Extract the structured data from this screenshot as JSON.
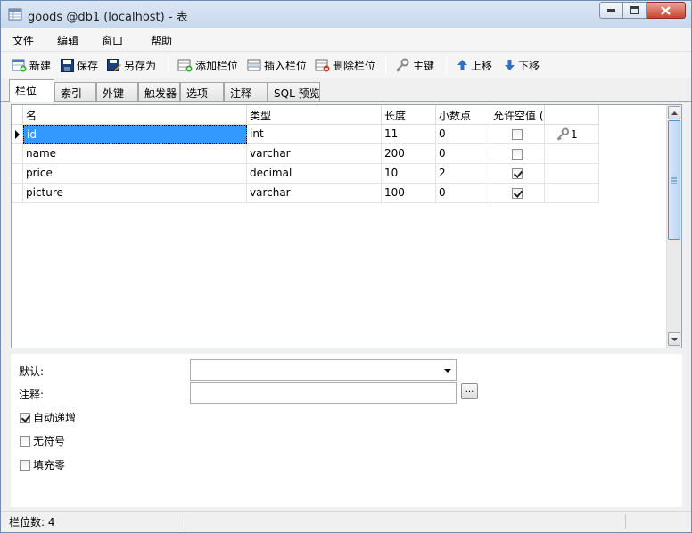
{
  "window": {
    "title": "goods @db1 (localhost) - 表"
  },
  "menu": [
    "文件",
    "编辑",
    "窗口",
    "帮助"
  ],
  "toolbar": {
    "new": "新建",
    "save": "保存",
    "save_as": "另存为",
    "add_field": "添加栏位",
    "insert_field": "插入栏位",
    "delete_field": "删除栏位",
    "primary_key": "主键",
    "move_up": "上移",
    "move_down": "下移"
  },
  "tabs": [
    "栏位",
    "索引",
    "外键",
    "触发器",
    "选项",
    "注释",
    "SQL 预览"
  ],
  "grid": {
    "columns": [
      "名",
      "类型",
      "长度",
      "小数点",
      "允许空值 (",
      ""
    ],
    "rows": [
      {
        "name": "id",
        "type": "int",
        "length": "11",
        "decimals": "0",
        "allow_null": false,
        "key": "1",
        "is_key": true,
        "selected": true
      },
      {
        "name": "name",
        "type": "varchar",
        "length": "200",
        "decimals": "0",
        "allow_null": false,
        "key": "",
        "is_key": false,
        "selected": false
      },
      {
        "name": "price",
        "type": "decimal",
        "length": "10",
        "decimals": "2",
        "allow_null": true,
        "key": "",
        "is_key": false,
        "selected": false
      },
      {
        "name": "picture",
        "type": "varchar",
        "length": "100",
        "decimals": "0",
        "allow_null": true,
        "key": "",
        "is_key": false,
        "selected": false
      }
    ]
  },
  "properties": {
    "default_label": "默认:",
    "default_value": "",
    "comment_label": "注释:",
    "comment_value": "",
    "ellipsis": "...",
    "auto_increment_label": "自动递增",
    "auto_increment": true,
    "unsigned_label": "无符号",
    "unsigned": false,
    "zerofill_label": "填充零",
    "zerofill": false
  },
  "status": {
    "field_count": "栏位数: 4"
  },
  "colors": {
    "selection": "#3399ff",
    "accent": "#1e6fc9"
  }
}
